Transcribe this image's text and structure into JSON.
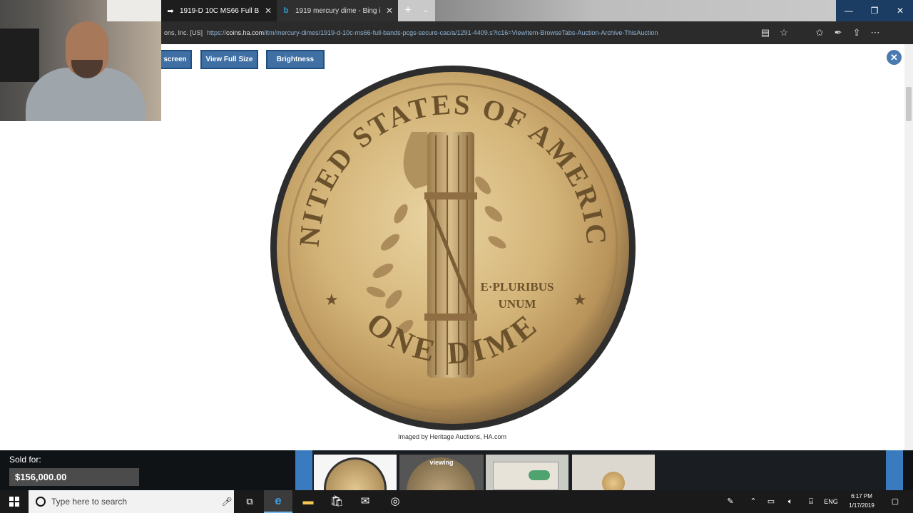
{
  "browser": {
    "tabs": [
      {
        "title": "1919-D 10C MS66 Full B",
        "favicon": "heritage-icon",
        "active": true
      },
      {
        "title": "1919 mercury dime - Bing i",
        "favicon": "bing-icon",
        "active": false
      }
    ],
    "address": {
      "site_label": "ons, Inc. [US]",
      "url_prefix": "https://",
      "url_domain": "coins.ha.com",
      "url_path": "/itm/mercury-dimes/1919-d-10c-ms66-full-bands-pcgs-secure-cac/a/1291-4409.s?ic16=ViewItem-BrowseTabs-Auction-Archive-ThisAuction"
    }
  },
  "viewer": {
    "buttons": {
      "fullscreen": "screen",
      "view_full_size": "View Full Size",
      "brightness": "Brightness"
    },
    "coin": {
      "legend_top": "UNITED STATES OF AMERICA",
      "motto_line1": "E·PLURIBUS",
      "motto_line2": "UNUM",
      "denomination": "ONE DIME"
    },
    "credit": "Imaged by Heritage Auctions, HA.com"
  },
  "gallery": {
    "sold_label": "Sold for:",
    "sold_price": "$156,000.00",
    "thumb_viewing_label": "viewing"
  },
  "taskbar": {
    "search_placeholder": "Type here to search",
    "language": "ENG",
    "time": "6:17 PM",
    "date": "1/17/2019"
  },
  "colors": {
    "viewer_button": "#3f6fa3",
    "thumb_accent": "#3a7bbf",
    "coin_gold": "#d4b579"
  }
}
